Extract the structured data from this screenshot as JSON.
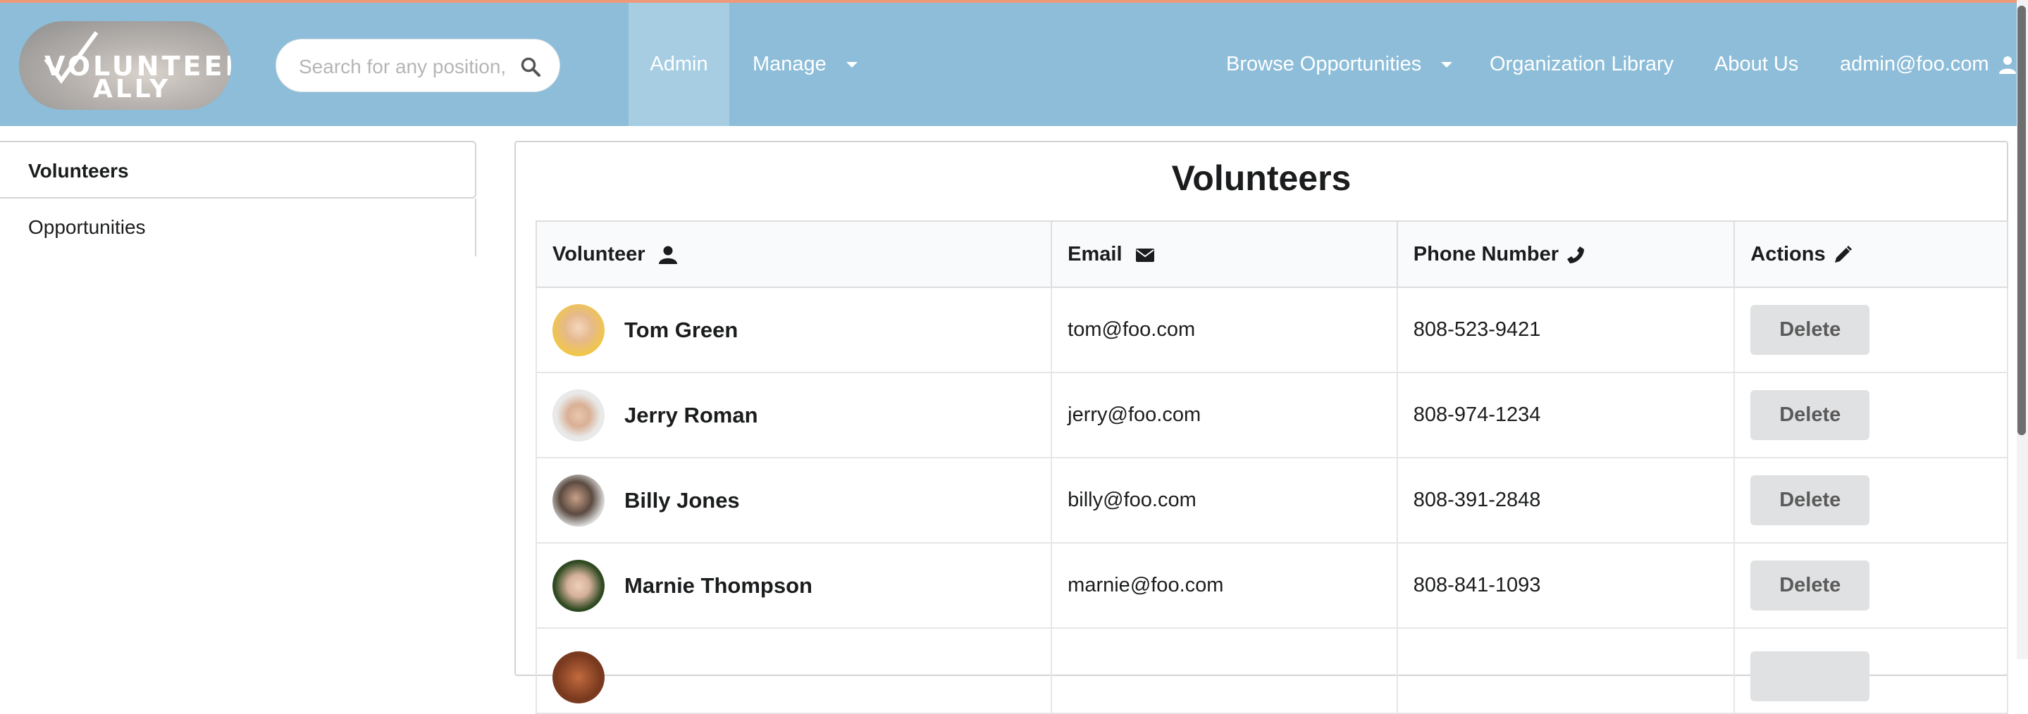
{
  "brand": {
    "logo_line1": "VOLUNTEER",
    "logo_line2": "ALLY",
    "accent_stripe": "#ee9a7a",
    "navbar_color": "#8dbdd8"
  },
  "search": {
    "placeholder": "Search for any position, l",
    "icon": "search-icon"
  },
  "nav": {
    "admin": "Admin",
    "manage": "Manage",
    "browse": "Browse Opportunities",
    "library": "Organization Library",
    "about": "About Us",
    "user": "admin@foo.com"
  },
  "sidebar": {
    "items": [
      {
        "label": "Volunteers",
        "active": true
      },
      {
        "label": "Opportunities",
        "active": false
      }
    ]
  },
  "main": {
    "title": "Volunteers",
    "columns": [
      {
        "label": "Volunteer",
        "icon": "user-icon"
      },
      {
        "label": "Email",
        "icon": "envelope-icon"
      },
      {
        "label": "Phone Number",
        "icon": "phone-icon"
      },
      {
        "label": "Actions",
        "icon": "pencil-icon"
      }
    ],
    "rows": [
      {
        "name": "Tom Green",
        "email": "tom@foo.com",
        "phone": "808-523-9421",
        "action": "Delete"
      },
      {
        "name": "Jerry Roman",
        "email": "jerry@foo.com",
        "phone": "808-974-1234",
        "action": "Delete"
      },
      {
        "name": "Billy Jones",
        "email": "billy@foo.com",
        "phone": "808-391-2848",
        "action": "Delete"
      },
      {
        "name": "Marnie Thompson",
        "email": "marnie@foo.com",
        "phone": "808-841-1093",
        "action": "Delete"
      },
      {
        "name": "",
        "email": "",
        "phone": "",
        "action": ""
      }
    ]
  }
}
